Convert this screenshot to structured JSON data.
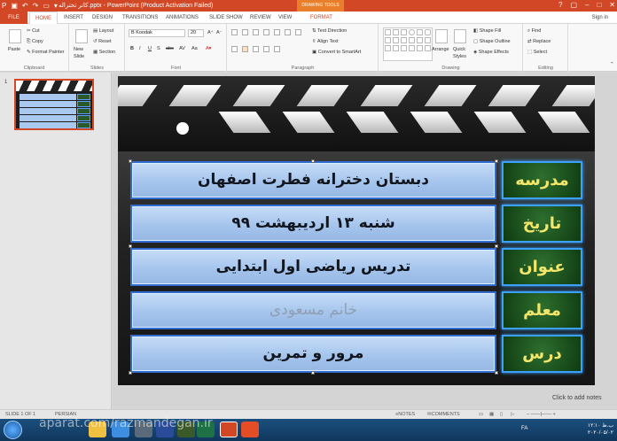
{
  "app": {
    "title": "کانر تختراله.pptx - PowerPoint (Product Activation Failed)",
    "contextual_group": "DRAWING TOOLS",
    "sign_in": "Sign in"
  },
  "tabs": [
    {
      "label": "FILE"
    },
    {
      "label": "HOME"
    },
    {
      "label": "INSERT"
    },
    {
      "label": "DESIGN"
    },
    {
      "label": "TRANSITIONS"
    },
    {
      "label": "ANIMATIONS"
    },
    {
      "label": "SLIDE SHOW"
    },
    {
      "label": "REVIEW"
    },
    {
      "label": "VIEW"
    },
    {
      "label": "FORMAT"
    }
  ],
  "ribbon": {
    "clipboard": {
      "label": "Clipboard",
      "paste": "Paste",
      "cut": "Cut",
      "copy": "Copy",
      "format_painter": "Format Painter"
    },
    "slides": {
      "label": "Slides",
      "new_slide": "New Slide",
      "layout": "Layout",
      "reset": "Reset",
      "section": "Section"
    },
    "font": {
      "label": "Font",
      "font_name": "B Koodak",
      "font_size": "20"
    },
    "paragraph": {
      "label": "Paragraph",
      "text_direction": "Text Direction",
      "align_text": "Align Text",
      "smartart": "Convert to SmartArt"
    },
    "drawing": {
      "label": "Drawing",
      "arrange": "Arrange",
      "quick_styles": "Quick Styles",
      "shape_fill": "Shape Fill",
      "shape_outline": "Shape Outline",
      "shape_effects": "Shape Effects"
    },
    "editing": {
      "label": "Editing",
      "find": "Find",
      "replace": "Replace",
      "select": "Select"
    }
  },
  "thumbnails": [
    {
      "number": "1"
    }
  ],
  "slide": {
    "rows": [
      {
        "label": "مدرسه",
        "value": "دبستان دخترانه فطرت اصفهان",
        "muted": false
      },
      {
        "label": "تاریخ",
        "value": "شنبه ۱۳ اردیبهشت ۹۹",
        "muted": false
      },
      {
        "label": "عنوان",
        "value": "تدریس ریاضی اول ابتدایی",
        "muted": false
      },
      {
        "label": "معلم",
        "value": "خانم مسعودی",
        "muted": true
      },
      {
        "label": "درس",
        "value": "مرور و تمرین",
        "muted": false
      }
    ],
    "notes_placeholder": "Click to add notes"
  },
  "status": {
    "slide_info": "SLIDE 1 OF 1",
    "language": "PERSIAN",
    "notes": "NOTES",
    "comments": "COMMENTS"
  },
  "taskbar": {
    "language": "FA",
    "time": "۱۲:۱۰ ب.ظ",
    "date": "۲۰۲۰/۰۵/۰۲",
    "watermark": "aparat.com/razmandegan.ir"
  },
  "colors": {
    "accent": "#d24726",
    "label_bg": "#1f5a20",
    "label_text": "#f3e66a",
    "value_bg": "#a9c8ef",
    "border_blue": "#2f6bd1"
  }
}
